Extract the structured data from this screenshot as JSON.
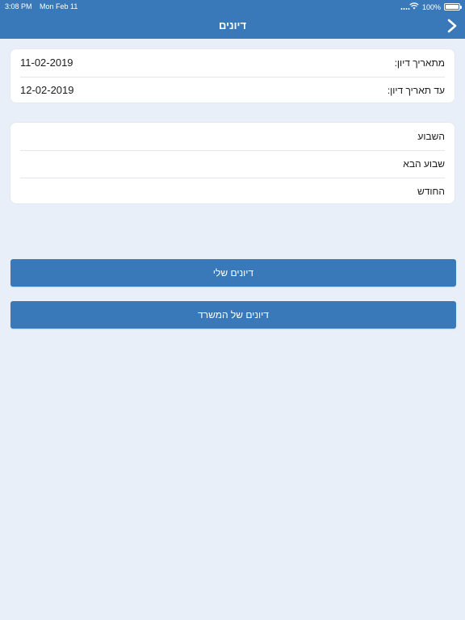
{
  "status_bar": {
    "time": "3:08 PM",
    "date": "Mon Feb 11",
    "battery": "100%"
  },
  "nav": {
    "title": "דיונים",
    "back_icon": "chevron-right-icon"
  },
  "date_filter": {
    "from_label": "מתאריך דיון:",
    "from_value": "11-02-2019",
    "to_label": "עד תאריך דיון:",
    "to_value": "12-02-2019"
  },
  "periods": {
    "items": [
      {
        "label": "השבוע"
      },
      {
        "label": "שבוע הבא"
      },
      {
        "label": "החודש"
      }
    ]
  },
  "buttons": {
    "my_hearings": "דיונים שלי",
    "office_hearings": "דיונים של המשרד"
  },
  "colors": {
    "primary": "#3a79b9",
    "background": "#e8eff8",
    "card": "#ffffff"
  }
}
